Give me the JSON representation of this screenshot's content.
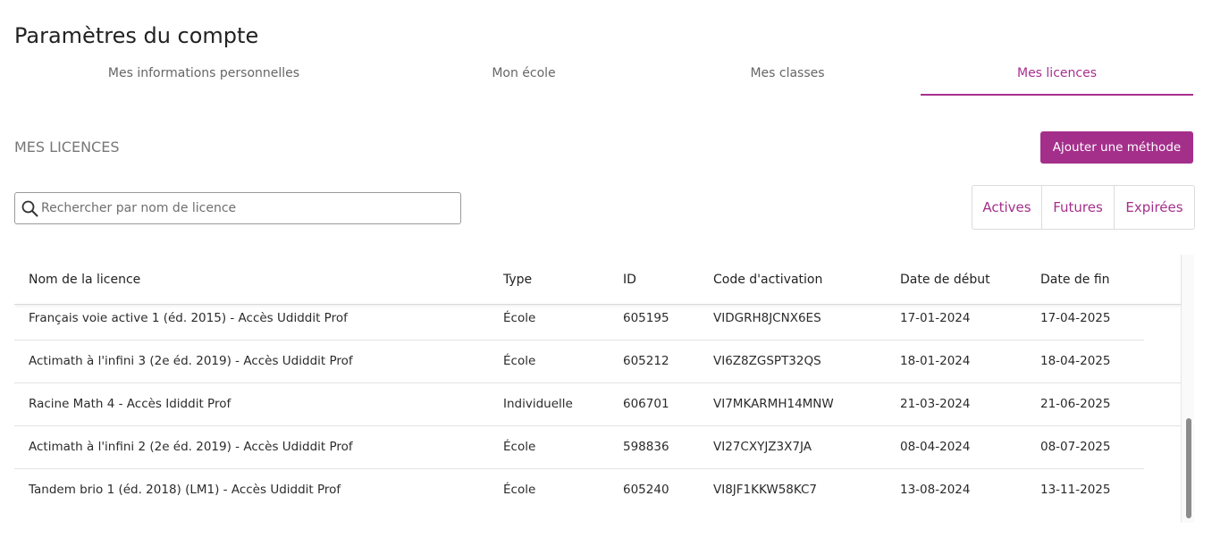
{
  "page": {
    "title": "Paramètres du compte"
  },
  "tabs": [
    {
      "label": "Mes informations personnelles"
    },
    {
      "label": "Mon école"
    },
    {
      "label": "Mes classes"
    },
    {
      "label": "Mes licences",
      "active": true
    }
  ],
  "section": {
    "title": "MES LICENCES",
    "add_button_label": "Ajouter une méthode"
  },
  "search": {
    "placeholder": "Rechercher par nom de licence",
    "value": ""
  },
  "filters": [
    {
      "label": "Actives"
    },
    {
      "label": "Futures"
    },
    {
      "label": "Expirées"
    }
  ],
  "table": {
    "columns": [
      "Nom de la licence",
      "Type",
      "ID",
      "Code d'activation",
      "Date de début",
      "Date de fin"
    ],
    "rows": [
      {
        "name": "Français voie active 1 (éd. 2015) - Accès Udiddit Prof",
        "type": "École",
        "id": "605195",
        "code": "VIDGRH8JCNX6ES",
        "start": "17-01-2024",
        "end": "17-04-2025"
      },
      {
        "name": "Actimath à l'infini 3 (2e éd. 2019) - Accès Udiddit Prof",
        "type": "École",
        "id": "605212",
        "code": "VI6Z8ZGSPT32QS",
        "start": "18-01-2024",
        "end": "18-04-2025"
      },
      {
        "name": "Racine Math 4 - Accès Ididdit Prof",
        "type": "Individuelle",
        "id": "606701",
        "code": "VI7MKARMH14MNW",
        "start": "21-03-2024",
        "end": "21-06-2025"
      },
      {
        "name": "Actimath à l'infini 2 (2e éd. 2019) - Accès Udiddit Prof",
        "type": "École",
        "id": "598836",
        "code": "VI27CXYJZ3X7JA",
        "start": "08-04-2024",
        "end": "08-07-2025"
      },
      {
        "name": "Tandem brio 1 (éd. 2018) (LM1) - Accès Udiddit Prof",
        "type": "École",
        "id": "605240",
        "code": "VI8JF1KKW58KC7",
        "start": "13-08-2024",
        "end": "13-11-2025"
      }
    ]
  },
  "colors": {
    "accent": "#a42f8b",
    "text": "#2b2b2b",
    "muted": "#666666",
    "border": "#dcdcdc"
  },
  "icons": {
    "search": "search-icon"
  }
}
